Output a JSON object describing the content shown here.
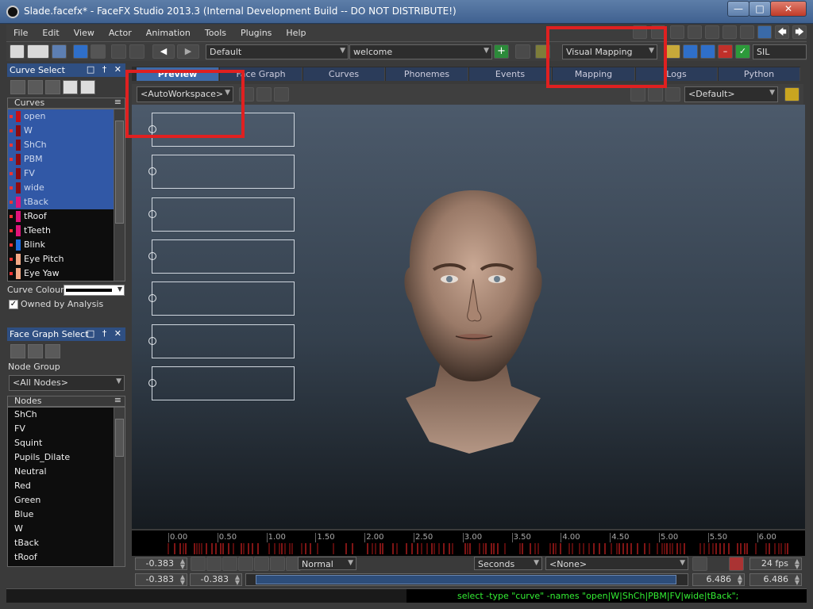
{
  "window": {
    "title": "Slade.facefx* - FaceFX Studio 2013.3 (Internal Development Build -- DO NOT DISTRIBUTE!)"
  },
  "menu": [
    "File",
    "Edit",
    "View",
    "Actor",
    "Animation",
    "Tools",
    "Plugins",
    "Help"
  ],
  "toolbar": {
    "workspace_combo": "Default",
    "animation_combo": "welcome",
    "mapping_combo": "Visual Mapping",
    "phoneme_field": "SIL"
  },
  "curve_select": {
    "title": "Curve Select",
    "list_header": "Curves",
    "curves": [
      {
        "name": "open",
        "color": "#c0101a",
        "selected": true
      },
      {
        "name": "W",
        "color": "#8a0b12",
        "selected": true
      },
      {
        "name": "ShCh",
        "color": "#8a0b12",
        "selected": true
      },
      {
        "name": "PBM",
        "color": "#8a0b12",
        "selected": true
      },
      {
        "name": "FV",
        "color": "#8a0b12",
        "selected": true
      },
      {
        "name": "wide",
        "color": "#8a0b12",
        "selected": true
      },
      {
        "name": "tBack",
        "color": "#e0147a",
        "selected": true
      },
      {
        "name": "tRoof",
        "color": "#e0147a",
        "selected": false
      },
      {
        "name": "tTeeth",
        "color": "#e0147a",
        "selected": false
      },
      {
        "name": "Blink",
        "color": "#1f6fe0",
        "selected": false
      },
      {
        "name": "Eye Pitch",
        "color": "#f2a886",
        "selected": false
      },
      {
        "name": "Eye Yaw",
        "color": "#f2a886",
        "selected": false
      }
    ],
    "curve_colour_label": "Curve Colour:",
    "owned_by_analysis_label": "Owned by Analysis",
    "owned_by_analysis_checked": true
  },
  "face_graph_select": {
    "title": "Face Graph Select",
    "node_group_label": "Node Group",
    "node_group_value": "<All Nodes>",
    "list_header": "Nodes",
    "nodes": [
      "ShCh",
      "FV",
      "Squint",
      "Pupils_Dilate",
      "Neutral",
      "Red",
      "Green",
      "Blue",
      "W",
      "tBack",
      "tRoof"
    ]
  },
  "tabs": [
    "Preview",
    "Face Graph",
    "Curves",
    "Phonemes",
    "Events",
    "Mapping",
    "Logs",
    "Python"
  ],
  "active_tab": "Preview",
  "workspace": {
    "combo": "<AutoWorkspace>",
    "camera_combo": "<Default>",
    "slot_count": 7
  },
  "timeline": {
    "ticks": [
      "0.00",
      "0.50",
      "1.00",
      "1.50",
      "2.00",
      "2.50",
      "3.00",
      "3.50",
      "4.00",
      "4.50",
      "5.00",
      "5.50",
      "6.00"
    ]
  },
  "playback": {
    "time_field": "-0.383",
    "range_start": "-0.383",
    "range_start2": "-0.383",
    "mode_combo": "Normal",
    "units_combo": "Seconds",
    "none_combo": "<None>",
    "fps_field": "24 fps",
    "end_time_a": "6.486",
    "end_time_b": "6.486",
    "end_time_c": "6.486"
  },
  "command_line": "select -type \"curve\" -names \"open|W|ShCh|PBM|FV|wide|tBack\";",
  "colors": {
    "accent": "#3158a6",
    "highlight_box": "#e02020",
    "command_text": "#33ee33"
  }
}
